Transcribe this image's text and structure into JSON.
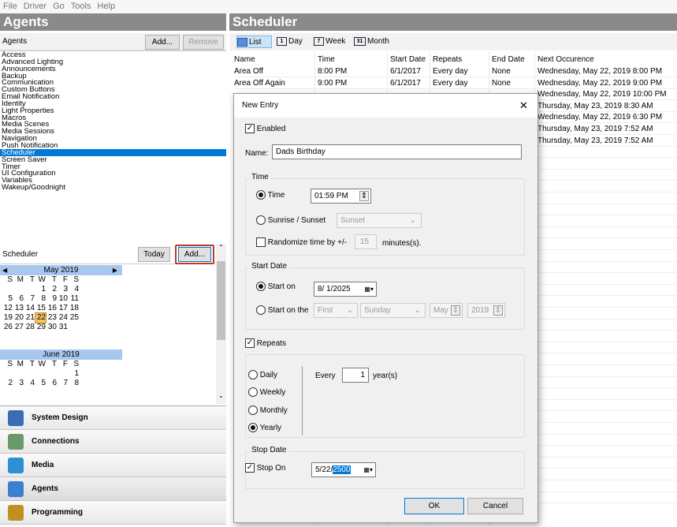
{
  "menubar": [
    "File",
    "Driver",
    "Go",
    "Tools",
    "Help"
  ],
  "agents": {
    "title": "Agents",
    "header": "Agents",
    "add_label": "Add...",
    "remove_label": "Remove",
    "items": [
      "Access",
      "Advanced Lighting",
      "Announcements",
      "Backup",
      "Communication",
      "Custom Buttons",
      "Email Notification",
      "Identity",
      "Light Properties",
      "Macros",
      "Media Scenes",
      "Media Sessions",
      "Navigation",
      "Push Notification",
      "Scheduler",
      "Screen Saver",
      "Timer",
      "UI Configuration",
      "Variables",
      "Wakeup/Goodnight"
    ],
    "selected": "Scheduler"
  },
  "scheduler_panel": {
    "label": "Scheduler",
    "today_label": "Today",
    "add_label": "Add..."
  },
  "calendar": {
    "dow": [
      "S",
      "M",
      "T",
      "W",
      "T",
      "F",
      "S"
    ],
    "months": [
      {
        "title": "May 2019",
        "days": [
          "",
          "",
          "",
          "1",
          "2",
          "3",
          "4",
          "5",
          "6",
          "7",
          "8",
          "9",
          "10",
          "11",
          "12",
          "13",
          "14",
          "15",
          "16",
          "17",
          "18",
          "19",
          "20",
          "21",
          "22",
          "23",
          "24",
          "25",
          "26",
          "27",
          "28",
          "29",
          "30",
          "31"
        ],
        "today": "22"
      },
      {
        "title": "June 2019",
        "days": [
          "",
          "",
          "",
          "",
          "",
          "",
          "1",
          "2",
          "3",
          "4",
          "5",
          "6",
          "7",
          "8"
        ]
      }
    ]
  },
  "nav": [
    {
      "label": "System Design",
      "icon": "system-design-icon"
    },
    {
      "label": "Connections",
      "icon": "connections-icon"
    },
    {
      "label": "Media",
      "icon": "media-icon"
    },
    {
      "label": "Agents",
      "icon": "agents-icon"
    },
    {
      "label": "Programming",
      "icon": "programming-icon"
    }
  ],
  "scheduler": {
    "title": "Scheduler",
    "toolbar": [
      {
        "label": "List",
        "icon": "list-icon"
      },
      {
        "label": "Day",
        "icon": "1"
      },
      {
        "label": "Week",
        "icon": "7"
      },
      {
        "label": "Month",
        "icon": "31"
      }
    ],
    "columns": [
      "Name",
      "Time",
      "Start Date",
      "Repeats",
      "End Date",
      "Next Occurence"
    ],
    "rows": [
      {
        "name": "Area Off",
        "time": "8:00 PM",
        "start": "6/1/2017",
        "repeats": "Every day",
        "end": "None",
        "next": "Wednesday, May 22, 2019 8:00 PM"
      },
      {
        "name": "Area Off Again",
        "time": "9:00 PM",
        "start": "6/1/2017",
        "repeats": "Every day",
        "end": "None",
        "next": "Wednesday, May 22, 2019 9:00 PM"
      },
      {
        "name": "",
        "time": "",
        "start": "",
        "repeats": "",
        "end": "",
        "next": "Wednesday, May 22, 2019 10:00 PM"
      },
      {
        "name": "",
        "time": "",
        "start": "",
        "repeats": "",
        "end": "",
        "next": "Thursday, May 23, 2019 8:30 AM"
      },
      {
        "name": "",
        "time": "",
        "start": "",
        "repeats": "",
        "end": "",
        "next": "Wednesday, May 22, 2019 6:30 PM"
      },
      {
        "name": "",
        "time": "",
        "start": "",
        "repeats": "",
        "end": "",
        "next": "Thursday, May 23, 2019 7:52 AM"
      },
      {
        "name": "",
        "time": "",
        "start": "",
        "repeats": "",
        "end": "",
        "next": "Thursday, May 23, 2019 7:52 AM"
      }
    ]
  },
  "dialog": {
    "title": "New Entry",
    "close": "✕",
    "enabled_label": "Enabled",
    "name_label": "Name:",
    "name_value": "Dads Birthday",
    "time_group": "Time",
    "time_label": "Time",
    "time_value": "01:59 PM",
    "sunrise_label": "Sunrise / Sunset",
    "sunrise_value": "Sunset",
    "randomize_label": "Randomize time by +/-",
    "randomize_value": "15",
    "minutes_label": "minutes(s).",
    "start_group": "Start Date",
    "start_on_label": "Start on",
    "start_on_value": "8/ 1/2025",
    "start_on_the_label": "Start on the",
    "first_value": "First",
    "sunday_value": "Sunday",
    "month_value": "May",
    "year_value": "2019",
    "repeats_label": "Repeats",
    "daily": "Daily",
    "weekly": "Weekly",
    "monthly": "Monthly",
    "yearly": "Yearly",
    "every_label": "Every",
    "every_value": "1",
    "every_unit": "year(s)",
    "stop_group": "Stop Date",
    "stop_on_label": "Stop On",
    "stop_on_value": "5/22/",
    "stop_on_sel": "2500",
    "ok": "OK",
    "cancel": "Cancel"
  },
  "colors": {
    "selection": "#0078d7",
    "pane_title": "#8a8a8a",
    "highlight_border": "#c0392b"
  }
}
